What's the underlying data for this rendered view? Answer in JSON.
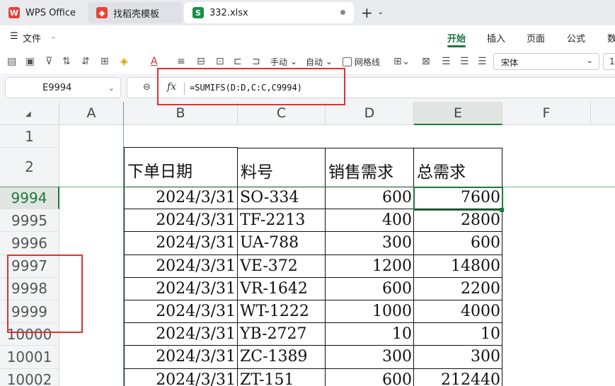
{
  "tabs": [
    {
      "label": "WPS Office",
      "icon": "wps-logo-icon"
    },
    {
      "label": "找稻壳模板",
      "icon": "docer-icon"
    },
    {
      "label": "332.xlsx",
      "icon": "spreadsheet-icon"
    }
  ],
  "menu": {
    "file": "文件",
    "items": [
      "开始",
      "插入",
      "页面",
      "公式",
      "数"
    ],
    "active": "开始"
  },
  "toolbar": {
    "manual": "手动",
    "auto": "自动",
    "gridlines": "网格线",
    "font": "宋体",
    "size": "1"
  },
  "namebox": "E9994",
  "formula": "=SUMIFS(D:D,C:C,C9994)",
  "columns": [
    "A",
    "B",
    "C",
    "D",
    "E",
    "F"
  ],
  "selected_column": "E",
  "header_row": {
    "row_labels": [
      "1",
      "2"
    ],
    "cells": [
      "下单日期",
      "料号",
      "销售需求",
      "总需求"
    ]
  },
  "rows": [
    {
      "row": "9994",
      "date": "2024/3/31",
      "part": "SO-334",
      "sales": "600",
      "total": "7600"
    },
    {
      "row": "9995",
      "date": "2024/3/31",
      "part": "TF-2213",
      "sales": "400",
      "total": "2800"
    },
    {
      "row": "9996",
      "date": "2024/3/31",
      "part": "UA-788",
      "sales": "300",
      "total": "600"
    },
    {
      "row": "9997",
      "date": "2024/3/31",
      "part": "VE-372",
      "sales": "1200",
      "total": "14800"
    },
    {
      "row": "9998",
      "date": "2024/3/31",
      "part": "VR-1642",
      "sales": "600",
      "total": "2200"
    },
    {
      "row": "9999",
      "date": "2024/3/31",
      "part": "WT-1222",
      "sales": "1000",
      "total": "4000"
    },
    {
      "row": "10000",
      "date": "2024/3/31",
      "part": "YB-2727",
      "sales": "10",
      "total": "10"
    },
    {
      "row": "10001",
      "date": "2024/3/31",
      "part": "ZC-1389",
      "sales": "300",
      "total": "300"
    },
    {
      "row": "10002",
      "date": "2024/3/31",
      "part": "ZT-151",
      "sales": "600",
      "total": "212440"
    }
  ],
  "colors": {
    "accent": "#1a7a3c",
    "annotation": "#e03131",
    "wps_red": "#e8433c"
  }
}
